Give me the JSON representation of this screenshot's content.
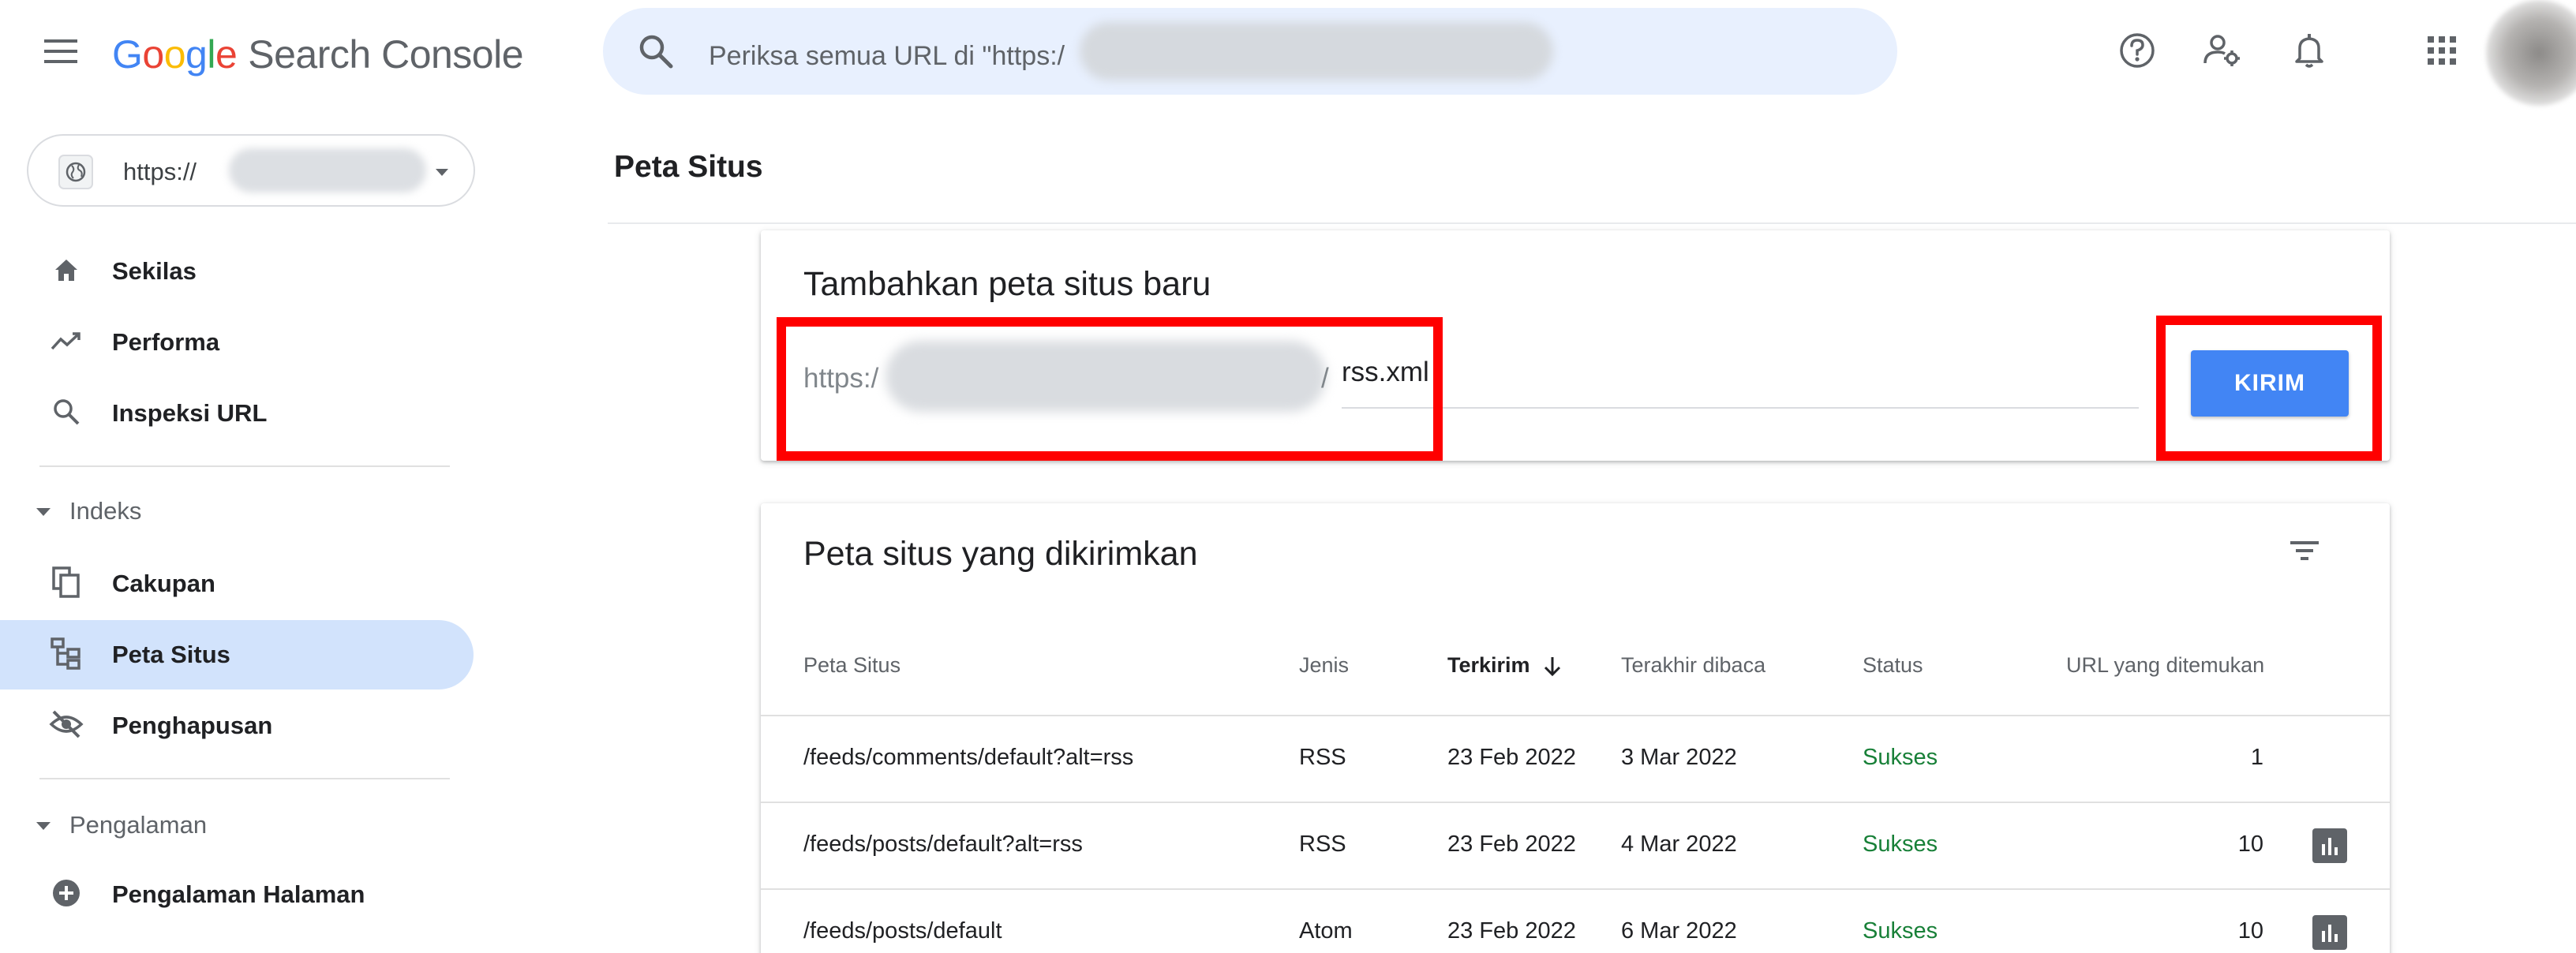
{
  "header": {
    "logo": {
      "g1": "G",
      "o1": "o",
      "o2": "o",
      "g2": "g",
      "l": "l",
      "e": "e",
      "product": "Search Console"
    },
    "search_placeholder": "Periksa semua URL di \"https:/"
  },
  "property": {
    "url_prefix": "https://"
  },
  "sidebar": {
    "items": [
      {
        "label": "Sekilas",
        "icon": "home-icon"
      },
      {
        "label": "Performa",
        "icon": "trending-up-icon"
      },
      {
        "label": "Inspeksi URL",
        "icon": "search-icon"
      }
    ],
    "sections": [
      {
        "label": "Indeks",
        "items": [
          {
            "label": "Cakupan",
            "icon": "copy-icon"
          },
          {
            "label": "Peta Situs",
            "icon": "sitemap-icon",
            "active": true
          },
          {
            "label": "Penghapusan",
            "icon": "visibility-off-icon"
          }
        ]
      },
      {
        "label": "Pengalaman",
        "items": [
          {
            "label": "Pengalaman Halaman",
            "icon": "add-circle-icon"
          }
        ]
      }
    ]
  },
  "main": {
    "page_title": "Peta Situs",
    "add_card": {
      "title": "Tambahkan peta situs baru",
      "url_prefix": "https:/",
      "url_slash": "/",
      "input_value": "rss.xml",
      "submit_label": "KIRIM"
    },
    "submitted_card": {
      "title": "Peta situs yang dikirimkan",
      "columns": [
        "Peta Situs",
        "Jenis",
        "Terkirim",
        "Terakhir dibaca",
        "Status",
        "URL yang ditemukan"
      ],
      "rows": [
        {
          "sitemap": "/feeds/comments/default?alt=rss",
          "type": "RSS",
          "submitted": "23 Feb 2022",
          "last_read": "3 Mar 2022",
          "status": "Sukses",
          "urls": "1"
        },
        {
          "sitemap": "/feeds/posts/default?alt=rss",
          "type": "RSS",
          "submitted": "23 Feb 2022",
          "last_read": "4 Mar 2022",
          "status": "Sukses",
          "urls": "10"
        },
        {
          "sitemap": "/feeds/posts/default",
          "type": "Atom",
          "submitted": "23 Feb 2022",
          "last_read": "6 Mar 2022",
          "status": "Sukses",
          "urls": "10"
        }
      ]
    }
  },
  "colors": {
    "accent": "#4285f4",
    "active_nav": "#d2e3fc",
    "success": "#188038",
    "highlight": "#ff0000",
    "search_bg": "#e8f0fe"
  }
}
